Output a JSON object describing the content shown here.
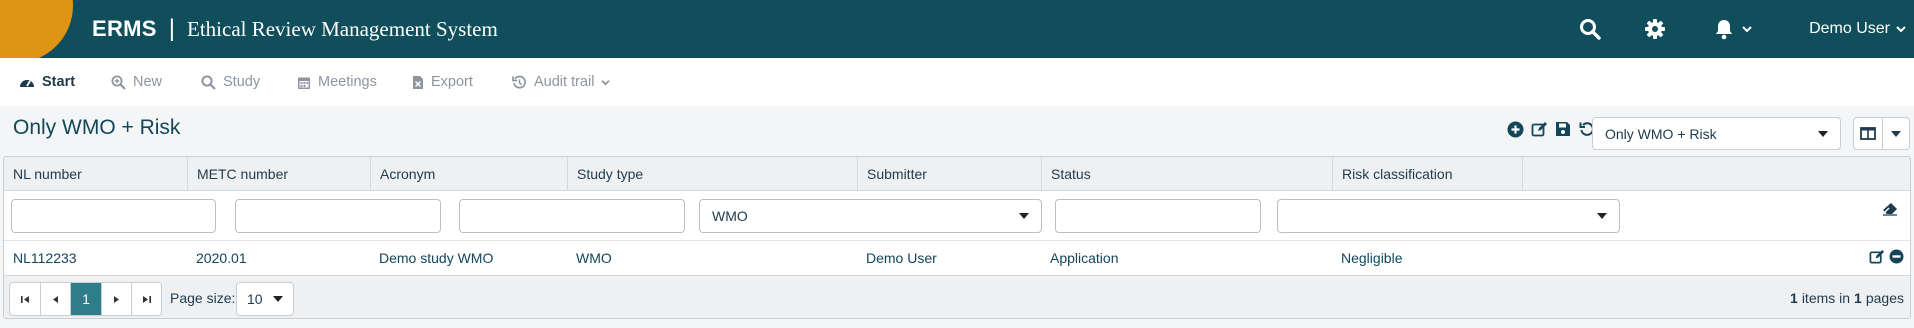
{
  "header": {
    "brand_short": "ERMS",
    "separator": "|",
    "brand_full": "Ethical Review Management System",
    "user_name": "Demo User",
    "colors": {
      "bar": "#0f4e5a",
      "logo": "#de9514"
    }
  },
  "nav": {
    "items": [
      {
        "label": "Start",
        "icon": "dashboard-icon"
      },
      {
        "label": "New",
        "icon": "zoom-plus-icon"
      },
      {
        "label": "Study",
        "icon": "search-icon"
      },
      {
        "label": "Meetings",
        "icon": "calendar-icon"
      },
      {
        "label": "Export",
        "icon": "file-export-icon"
      },
      {
        "label": "Audit trail",
        "icon": "history-icon"
      }
    ]
  },
  "page": {
    "title": "Only WMO + Risk",
    "view_select_value": "Only WMO + Risk"
  },
  "grid": {
    "columns": [
      "NL number",
      "METC number",
      "Acronym",
      "Study type",
      "Submitter",
      "Status",
      "Risk classification"
    ],
    "filters": {
      "study_type": "WMO"
    },
    "rows": [
      {
        "nl_number": "NL112233",
        "metc_number": "2020.01",
        "acronym": "Demo study WMO",
        "study_type": "WMO",
        "submitter": "Demo User",
        "status": "Application",
        "risk": "Negligible"
      }
    ],
    "pager": {
      "current_page": "1",
      "page_size_label": "Page size:",
      "page_size": "10",
      "items_count": "1",
      "items_text": "items in",
      "pages_count": "1",
      "pages_text": "pages"
    }
  }
}
